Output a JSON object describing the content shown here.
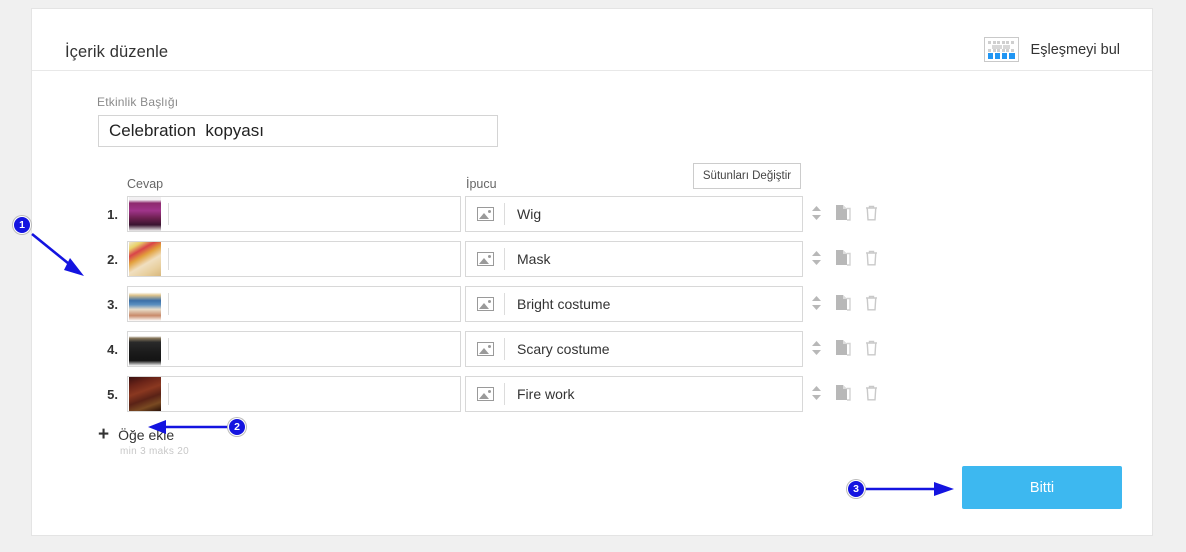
{
  "header": {
    "title": "İçerik düzenle",
    "match_button_label": "Eşleşmeyi bul",
    "match_icon": "matching-grid-icon"
  },
  "form": {
    "title_field_label": "Etkinlik Başlığı",
    "title_field_value": "Celebration  kopyası",
    "title_field_placeholder": "Etkinlik Başlığı"
  },
  "table": {
    "columns": [
      "Cevap",
      "İpucu"
    ],
    "switch_columns_button": "Sütunları Değiştir",
    "row_icons": {
      "sort": "sort-updown-icon",
      "duplicate": "duplicate-icon",
      "delete": "trash-icon",
      "image_placeholder": "image-placeholder-icon"
    },
    "rows": [
      {
        "number": "1.",
        "answer_image": "purple-haired-character-thumbnail",
        "answer_text": "",
        "hint": "Wig"
      },
      {
        "number": "2.",
        "answer_image": "colorful-mask-thumbnail",
        "answer_text": "",
        "hint": "Mask"
      },
      {
        "number": "3.",
        "answer_image": "bright-costume-figure-thumbnail",
        "answer_text": "",
        "hint": "Bright costume"
      },
      {
        "number": "4.",
        "answer_image": "dark-robed-figure-thumbnail",
        "answer_text": "",
        "hint": "Scary costume"
      },
      {
        "number": "5.",
        "answer_image": "fireworks-thumbnail",
        "answer_text": "",
        "hint": "Fire work"
      }
    ]
  },
  "add_item": {
    "label": "Öğe ekle",
    "plus_icon": "plus-icon",
    "constraint": "min 3  maks 20"
  },
  "footer": {
    "done_label": "Bitti"
  },
  "annotations": [
    {
      "id": "1",
      "label": "1"
    },
    {
      "id": "2",
      "label": "2"
    },
    {
      "id": "3",
      "label": "3"
    }
  ],
  "colors": {
    "accent_button": "#3db8f0",
    "annotation": "#1414e0",
    "page_background": "#f0f0f0",
    "card_background": "#ffffff"
  }
}
